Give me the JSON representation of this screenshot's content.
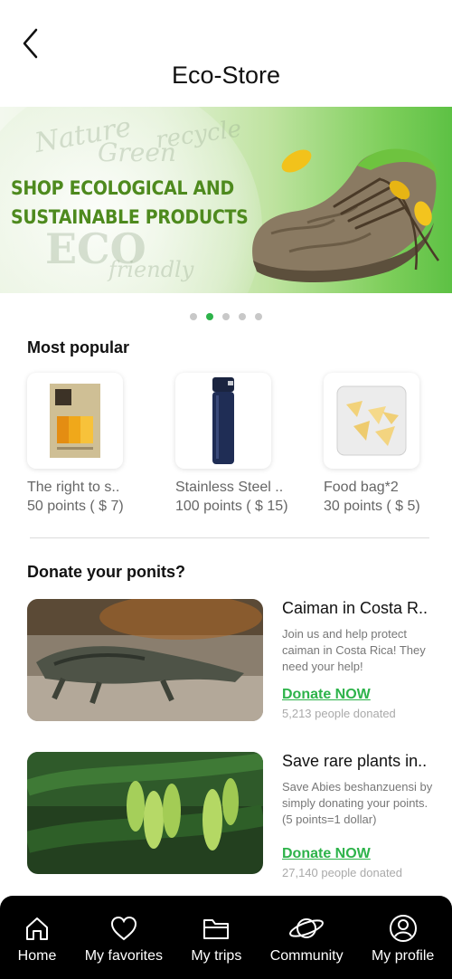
{
  "header": {
    "back_icon": "chevron-left-icon",
    "title": "Eco-Store"
  },
  "banner": {
    "headline_line1": "SHOP ECOLOGICAL AND",
    "headline_line2": "SUSTAINABLE PRODUCTS",
    "watermark_words": [
      "Nature",
      "recycle",
      "Green",
      "ECO",
      "friendly"
    ],
    "carousel_pages": 5,
    "carousel_active_index": 1
  },
  "popular": {
    "title": "Most popular",
    "items": [
      {
        "name": "The right to s..",
        "points": "50 points ( $ 7)",
        "icon": "soap-bar-icon"
      },
      {
        "name": "Stainless Steel ..",
        "points": "100 points ( $ 15)",
        "icon": "thermos-bottle-icon"
      },
      {
        "name": "Food bag*2",
        "points": "30 points ( $ 5)",
        "icon": "food-bag-icon"
      }
    ]
  },
  "donate": {
    "title": "Donate your ponits?",
    "items": [
      {
        "title": "Caiman in Costa R..",
        "description": "Join us and help protect caiman in Costa Rica! They need your help!",
        "link": "Donate NOW",
        "count": "5,213 people donated"
      },
      {
        "title": "Save rare plants in..",
        "description": "Save Abies beshanzuensi by simply donating your points. (5 points=1 dollar)",
        "link": "Donate NOW",
        "count": "27,140 people donated"
      }
    ]
  },
  "tabs": [
    {
      "label": "Home",
      "icon": "home-icon"
    },
    {
      "label": "My favorites",
      "icon": "heart-icon"
    },
    {
      "label": "My trips",
      "icon": "folder-icon"
    },
    {
      "label": "Community",
      "icon": "planet-icon"
    },
    {
      "label": "My profile",
      "icon": "profile-icon"
    }
  ],
  "colors": {
    "accent": "#2db34a",
    "banner_text": "#4e8a1e",
    "tabbar": "#000000"
  }
}
